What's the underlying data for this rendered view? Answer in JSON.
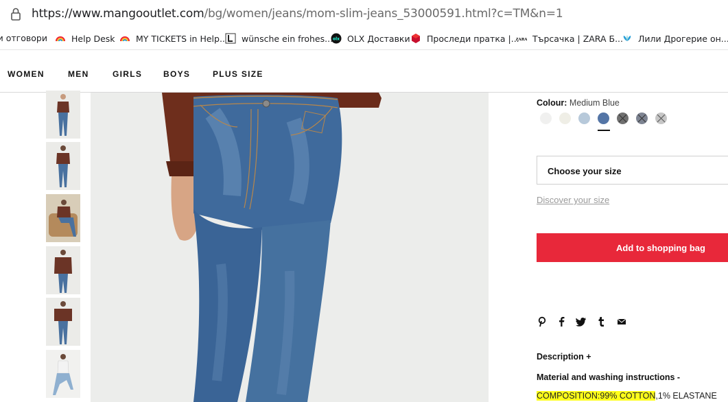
{
  "browser": {
    "url_host": "https://www.mangooutlet.com",
    "url_path": "/bg/women/jeans/mom-slim-jeans_53000591.html?c=TM&n=1"
  },
  "bookmarks": [
    {
      "label": "зи отговори",
      "icon": "bookmark-icon"
    },
    {
      "label": "Help Desk",
      "icon": "rainbow-icon"
    },
    {
      "label": "MY TICKETS in Help...",
      "icon": "rainbow-icon"
    },
    {
      "label": "wünsche ein frohes...",
      "icon": "letter-l-icon"
    },
    {
      "label": "OLX Доставки",
      "icon": "olx-icon"
    },
    {
      "label": "Проследи пратка |...",
      "icon": "dpd-cube-icon"
    },
    {
      "label": "Търсачка | ZARA Б...",
      "icon": "zara-icon"
    },
    {
      "label": "Лили Дрогерие он...",
      "icon": "lily-icon"
    }
  ],
  "nav": [
    "WOMEN",
    "MEN",
    "GIRLS",
    "BOYS",
    "PLUS SIZE"
  ],
  "product": {
    "colour_label": "Colour:",
    "colour_value": "Medium Blue",
    "swatches": [
      {
        "color": "#f0f0ef",
        "crossed": false
      },
      {
        "color": "#efeee6",
        "crossed": false
      },
      {
        "color": "#b7c9da",
        "crossed": false
      },
      {
        "color": "#5475a6",
        "crossed": false,
        "selected": true
      },
      {
        "color": "#707070",
        "crossed": true
      },
      {
        "color": "#7e8492",
        "crossed": true
      },
      {
        "color": "#c6c6c6",
        "crossed": true
      }
    ],
    "size_placeholder": "Choose your size",
    "discover_size": "Discover your size",
    "add_to_bag": "Add to shopping bag",
    "description_label": "Description +",
    "material_label": "Material and washing instructions -",
    "composition_highlight": "COMPOSITION:99% COTTON",
    "composition_rest": ",1% ELASTANE"
  },
  "social_icons": [
    "pinterest-icon",
    "facebook-icon",
    "twitter-icon",
    "tumblr-icon",
    "email-icon"
  ],
  "colors": {
    "accent": "#e8283a",
    "highlight": "#ffff1a",
    "denim": "#3e6799"
  }
}
